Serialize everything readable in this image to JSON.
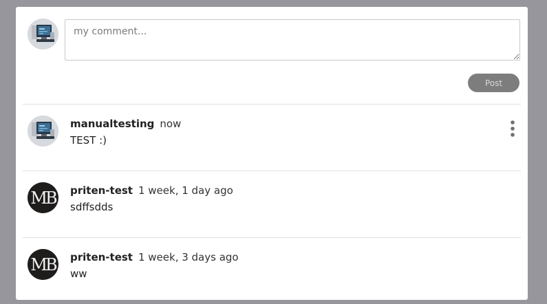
{
  "composer": {
    "placeholder": "my comment...",
    "post_label": "Post",
    "avatar_icon": "screen-avatar-icon"
  },
  "comments": [
    {
      "author": "manualtesting",
      "time": "now",
      "body": "TEST :)",
      "avatar": "screen-avatar-icon",
      "has_menu": true,
      "menu_icon": "more-vertical-icon"
    },
    {
      "author": "priten-test",
      "time": "1 week, 1 day ago",
      "body": "sdffsdds",
      "avatar": "mb-logo-avatar",
      "avatar_text": "MB"
    },
    {
      "author": "priten-test",
      "time": "1 week, 3 days ago",
      "body": "ww",
      "avatar": "mb-logo-avatar",
      "avatar_text": "MB"
    }
  ],
  "colors": {
    "backdrop": "#97969c",
    "panel": "#ffffff",
    "post_button": "#7d7d7d",
    "divider": "#e1e1e1",
    "mb_avatar": "#1f1c1c"
  }
}
